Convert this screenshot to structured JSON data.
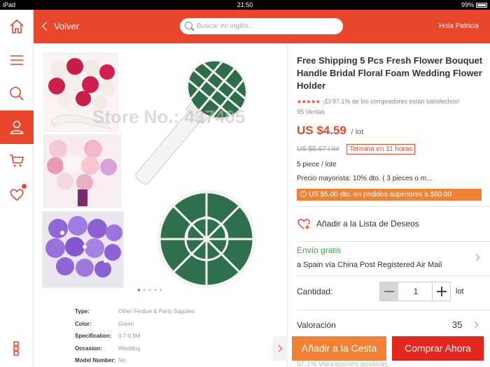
{
  "status_bar": {
    "device": "iPad",
    "time": "21:50",
    "battery": "99%"
  },
  "header": {
    "back_label": "Volver",
    "search_placeholder": "Buscar en inglés...",
    "greeting": "Hola Patricia"
  },
  "sidebar": {
    "items": [
      {
        "name": "home",
        "icon": "home-icon"
      },
      {
        "name": "menu",
        "icon": "menu-icon"
      },
      {
        "name": "search",
        "icon": "search-icon"
      },
      {
        "name": "account",
        "icon": "user-icon",
        "active": true
      },
      {
        "name": "cart",
        "icon": "cart-icon"
      },
      {
        "name": "wishlist",
        "icon": "heart-icon"
      },
      {
        "name": "more",
        "icon": "grid-icon"
      }
    ]
  },
  "gallery": {
    "watermark": "Store No.: 437405",
    "dot_count": 5,
    "active_dot": 0
  },
  "specs": [
    {
      "key": "Type:",
      "value": "Other Festive & Party Supplies"
    },
    {
      "key": "Color:",
      "value": "Green"
    },
    {
      "key": "Specification:",
      "value": "0.7-0.9M"
    },
    {
      "key": "Occasion:",
      "value": "Wedding"
    },
    {
      "key": "Model Number:",
      "value": "No"
    }
  ],
  "product": {
    "title": "Free Shipping 5 Pcs  Fresh Flower Bouquet Handle Bridal Floral Foam Wedding Flower Holder",
    "stars": "★★★★★",
    "satisfaction": "¡El 97.1% de los compradores están satisfechos!",
    "sold": "95 Ventas",
    "price": "US $4.59",
    "price_unit": "/ lot",
    "old_price": "US $5.67 / lot",
    "deadline": "Termina en 11 horas",
    "pack": "5 piece / lote",
    "wholesale": "Precio mayorista: 10% dto. ( 3 pieces o m...",
    "coupon": "US $5.00 dto. en pedidos superiores a $80.00",
    "wishlist_label": "Añadir a la Lista de Deseos",
    "shipping_free": "Envío gratis",
    "shipping_info": "a Spain vía China Post Registered Air Mail",
    "quantity_label": "Cantidad:",
    "quantity_value": "1",
    "quantity_unit": "lot",
    "rating_label": "Valoración",
    "rating_count": "35",
    "faded_text": "97.1% Valoraciones positivas"
  },
  "actions": {
    "add_to_cart": "Añadir a la Cesta",
    "buy_now": "Comprar Ahora"
  },
  "colors": {
    "brand": "#e8472c",
    "orange": "#f38133",
    "buy_red": "#e4261c",
    "green": "#3ea544"
  }
}
